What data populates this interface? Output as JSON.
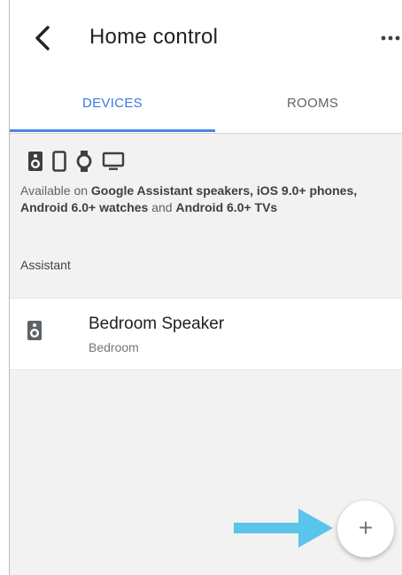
{
  "header": {
    "back_icon": "chevron-left-icon",
    "title": "Home control",
    "more_icon": "more-horiz-icon"
  },
  "tabs": [
    {
      "label": "DEVICES",
      "selected": true
    },
    {
      "label": "ROOMS",
      "selected": false
    }
  ],
  "info": {
    "icons": [
      "speaker-icon",
      "phone-icon",
      "watch-icon",
      "tv-icon"
    ],
    "text_prefix": "Available on ",
    "text_bold_1": "Google Assistant speakers, iOS 9.0+ phones, Android 6.0+ watches",
    "text_mid": " and ",
    "text_bold_2": "Android 6.0+ TVs"
  },
  "section": {
    "header": "Assistant"
  },
  "devices": [
    {
      "name": "Bedroom Speaker",
      "room": "Bedroom",
      "icon": "speaker-icon"
    }
  ],
  "fab": {
    "label": "+",
    "icon": "add-icon"
  },
  "colors": {
    "accent": "#3b78e7",
    "arrow": "#5bc4ea"
  }
}
